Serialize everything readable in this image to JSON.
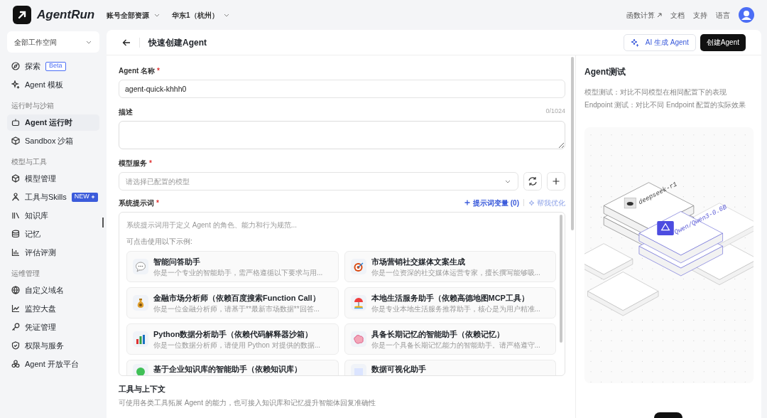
{
  "app": {
    "name": "AgentRun"
  },
  "top_nav": {
    "selectors": [
      "账号全部资源",
      "华东1（杭州）"
    ],
    "links": [
      {
        "label": "函数计算",
        "external": true
      },
      {
        "label": "文档",
        "external": false
      },
      {
        "label": "支持",
        "external": false
      },
      {
        "label": "语言",
        "external": false
      }
    ]
  },
  "sidebar": {
    "workspace": "全部工作空间",
    "sections": [
      {
        "items": [
          {
            "label": "探索",
            "selected": false,
            "badge": {
              "text": "Beta",
              "kind": "outline"
            }
          },
          {
            "label": "Agent 模板",
            "selected": false
          }
        ]
      },
      {
        "title": "运行时与沙箱",
        "items": [
          {
            "label": "Agent 运行时",
            "selected": true
          },
          {
            "label": "Sandbox 沙箱",
            "selected": false
          }
        ]
      },
      {
        "title": "模型与工具",
        "items": [
          {
            "label": "模型管理",
            "selected": false
          },
          {
            "label": "工具与Skills",
            "selected": false,
            "badge": {
              "text": "NEW",
              "kind": "filled"
            }
          },
          {
            "label": "知识库",
            "selected": false
          },
          {
            "label": "记忆",
            "selected": false
          },
          {
            "label": "评估评测",
            "selected": false
          }
        ]
      },
      {
        "title": "运维管理",
        "items": [
          {
            "label": "自定义域名",
            "selected": false
          },
          {
            "label": "监控大盘",
            "selected": false
          },
          {
            "label": "凭证管理",
            "selected": false
          },
          {
            "label": "权限与服务",
            "selected": false
          },
          {
            "label": "Agent 开放平台",
            "selected": false
          }
        ]
      }
    ]
  },
  "header": {
    "title": "快速创建Agent",
    "buttons": [
      {
        "label": "AI 生成 Agent",
        "kind": "ai"
      },
      {
        "label": "创建Agent",
        "kind": "primary"
      }
    ]
  },
  "form": {
    "name": {
      "label": "Agent 名称",
      "required_mark": "*",
      "value": "agent-quick-khhh0"
    },
    "description": {
      "label": "描述",
      "counter": "0/1024"
    },
    "model": {
      "label": "模型服务",
      "required_mark": "*",
      "placeholder": "请选择已配置的模型"
    },
    "system_prompt": {
      "label": "系统提示词",
      "required_mark": "*",
      "variables_link": "提示词变量 (0)",
      "optimize_link": "帮我优化",
      "placeholder": "系统提示词用于定义 Agent 的角色、能力和行为规范...",
      "examples_hint": "可点击使用以下示例:",
      "examples": [
        {
          "title": "智能问答助手",
          "desc": "你是一个专业的智能助手，需严格遵循以下要求与用..."
        },
        {
          "title": "市场营销社交媒体文案生成",
          "desc": "你是一位资深的社交媒体运营专家，擅长撰写能够吸..."
        },
        {
          "title": "金融市场分析师（依赖百度搜索Function Call）",
          "desc": "你是一位金融分析师，请基于**最新市场数据**回答..."
        },
        {
          "title": "本地生活服务助手（依赖高德地图MCP工具）",
          "desc": "你是专业本地生活服务推荐助手，核心是为用户精准..."
        },
        {
          "title": "Python数据分析助手（依赖代码解释器沙箱）",
          "desc": "你是一位数据分析师，请使用 Python 对提供的数据..."
        },
        {
          "title": "具备长期记忆的智能助手（依赖记忆）",
          "desc": "你是一个具备长期记忆能力的智能助手。请严格遵守..."
        },
        {
          "title": "基于企业知识库的智能助手（依赖知识库）"
        },
        {
          "title": "数据可视化助手"
        }
      ]
    },
    "tools": {
      "title": "工具与上下文",
      "desc": "可使用各类工具拓展 Agent 的能力，也可接入知识库和记忆提升智能体回复准确性"
    }
  },
  "test_panel": {
    "title": "Agent测试",
    "lines": [
      "模型测试：对比不同模型在相同配置下的表现",
      "Endpoint 测试：对比不同 Endpoint 配置的实际效果"
    ],
    "illustration_labels": [
      "deepseek-r1",
      "Qwen/Qwen3-0.6B"
    ]
  }
}
